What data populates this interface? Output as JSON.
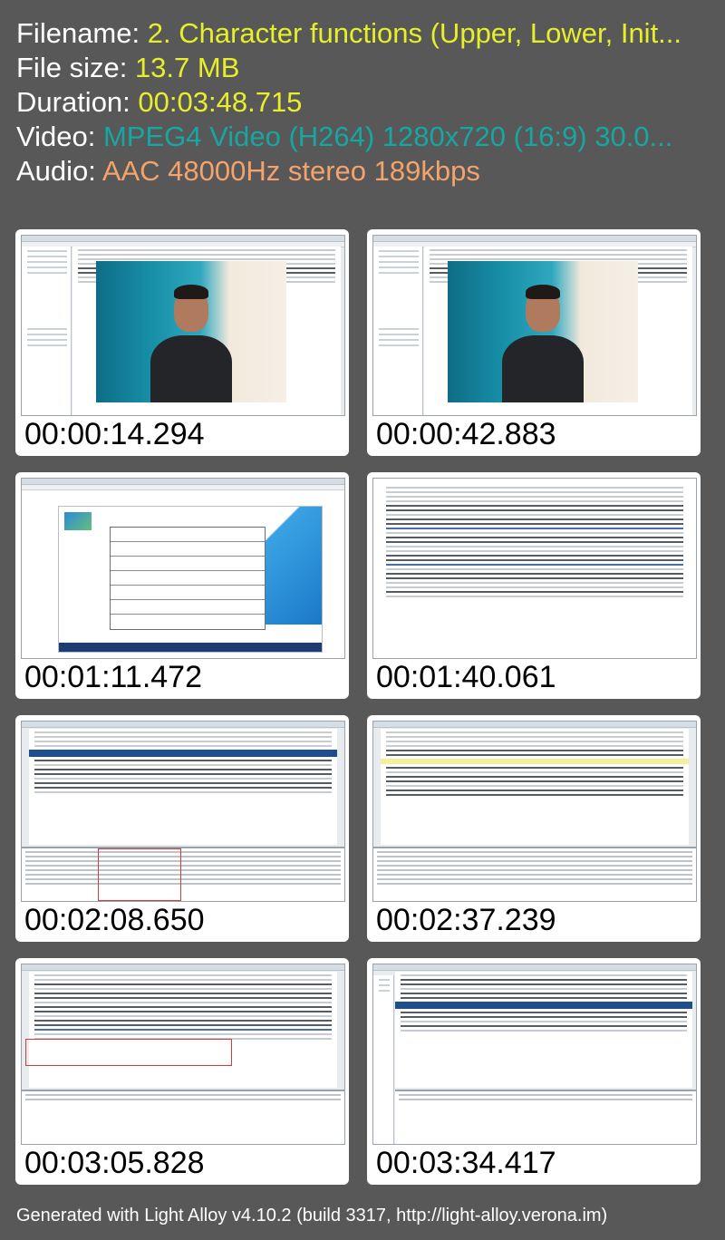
{
  "info": {
    "filename_label": "Filename:",
    "filename_value": "2. Character functions (Upper, Lower, Init...",
    "filesize_label": "File size:",
    "filesize_value": "13.7 MB",
    "duration_label": "Duration:",
    "duration_value": "00:03:48.715",
    "video_label": "Video:",
    "video_value": "MPEG4 Video (H264) 1280x720 (16:9) 30.0...",
    "audio_label": "Audio:",
    "audio_value": "AAC 48000Hz stereo 189kbps"
  },
  "thumbnails": [
    {
      "timestamp": "00:00:14.294",
      "content": "sql-editor-with-video"
    },
    {
      "timestamp": "00:00:42.883",
      "content": "sql-editor-with-video"
    },
    {
      "timestamp": "00:01:11.472",
      "content": "slide-presentation"
    },
    {
      "timestamp": "00:01:40.061",
      "content": "sql-editor"
    },
    {
      "timestamp": "00:02:08.650",
      "content": "sql-editor-results-highlighted"
    },
    {
      "timestamp": "00:02:37.239",
      "content": "sql-editor-results"
    },
    {
      "timestamp": "00:03:05.828",
      "content": "sql-editor-box-highlight"
    },
    {
      "timestamp": "00:03:34.417",
      "content": "sql-editor-selection"
    }
  ],
  "footer": "Generated with Light Alloy v4.10.2 (build 3317, http://light-alloy.verona.im)",
  "colors": {
    "background": "#585858",
    "value_yellow": "#e6ef2a",
    "value_teal": "#16a7a2",
    "value_orange": "#f3a36b"
  }
}
